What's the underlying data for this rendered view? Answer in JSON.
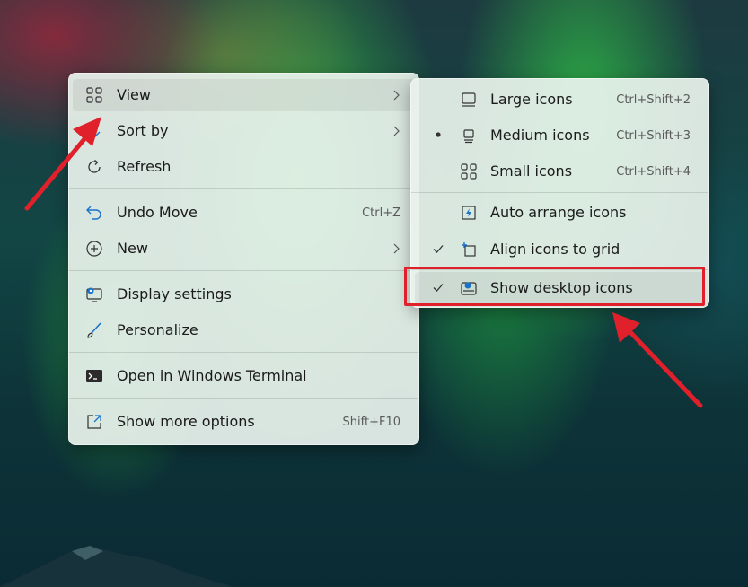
{
  "context_menu": {
    "items": [
      {
        "label": "View",
        "icon": "view-grid-icon",
        "submenu": true
      },
      {
        "label": "Sort by",
        "icon": "sort-arrow-icon",
        "submenu": true
      },
      {
        "label": "Refresh",
        "icon": "refresh-icon"
      },
      {
        "label": "Undo Move",
        "icon": "undo-icon",
        "shortcut": "Ctrl+Z"
      },
      {
        "label": "New",
        "icon": "plus-circle-icon",
        "submenu": true
      },
      {
        "label": "Display settings",
        "icon": "display-settings-icon"
      },
      {
        "label": "Personalize",
        "icon": "brush-icon"
      },
      {
        "label": "Open in Windows Terminal",
        "icon": "terminal-icon"
      },
      {
        "label": "Show more options",
        "icon": "share-icon",
        "shortcut": "Shift+F10"
      }
    ]
  },
  "view_submenu": {
    "items": [
      {
        "label": "Large icons",
        "icon": "large-icons-icon",
        "shortcut": "Ctrl+Shift+2",
        "selected": false
      },
      {
        "label": "Medium icons",
        "icon": "medium-icons-icon",
        "shortcut": "Ctrl+Shift+3",
        "selected": true
      },
      {
        "label": "Small icons",
        "icon": "small-icons-icon",
        "shortcut": "Ctrl+Shift+4",
        "selected": false
      },
      {
        "label": "Auto arrange icons",
        "icon": "auto-arrange-icon",
        "checked": false
      },
      {
        "label": "Align icons to grid",
        "icon": "align-grid-icon",
        "checked": true
      },
      {
        "label": "Show desktop icons",
        "icon": "show-desktop-icon",
        "checked": true
      }
    ]
  },
  "colors": {
    "annotation": "#e0202a",
    "accent": "#1a73c8"
  }
}
